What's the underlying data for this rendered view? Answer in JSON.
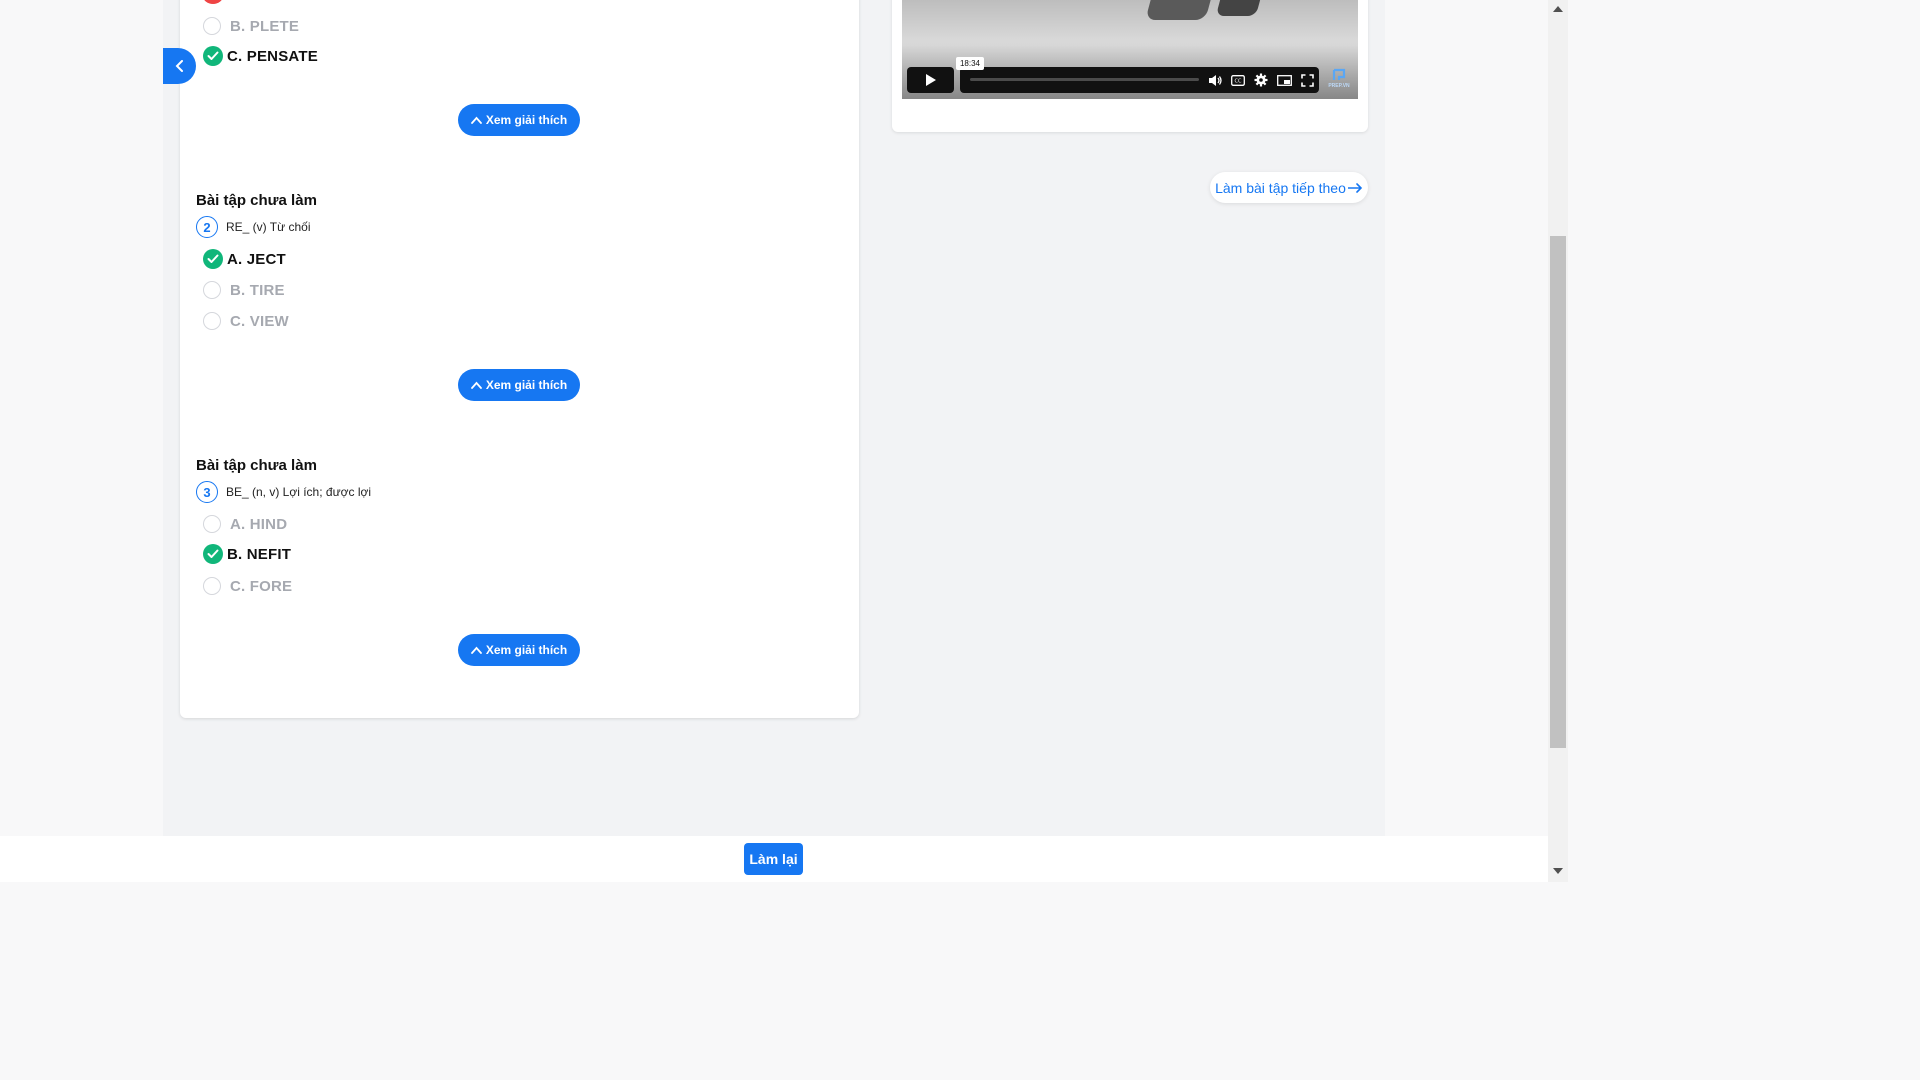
{
  "quiz": {
    "q1_tail": {
      "options": [
        {
          "label": "B. PLETE",
          "state": "unselected"
        },
        {
          "label": "C. PENSATE",
          "state": "correct"
        }
      ]
    },
    "explain_label": "Xem giải thích",
    "questions": [
      {
        "status": "Bài tập chưa làm",
        "number": "2",
        "prompt": "RE_ (v) Từ chối",
        "options": [
          {
            "label": "A. JECT",
            "state": "correct"
          },
          {
            "label": "B. TIRE",
            "state": "unselected"
          },
          {
            "label": "C. VIEW",
            "state": "unselected"
          }
        ]
      },
      {
        "status": "Bài tập chưa làm",
        "number": "3",
        "prompt": "BE_ (n, v) Lợi ích; được lợi",
        "options": [
          {
            "label": "A. HIND",
            "state": "unselected"
          },
          {
            "label": "B. NEFIT",
            "state": "correct"
          },
          {
            "label": "C. FORE",
            "state": "unselected"
          }
        ]
      }
    ]
  },
  "video": {
    "time_tooltip": "18:34",
    "logo_text": "PREP.VN",
    "icons": [
      "play-icon",
      "volume-icon",
      "captions-icon",
      "settings-icon",
      "pip-icon",
      "fullscreen-icon"
    ]
  },
  "next_exercise_label": "Làm bài tập tiếp theo",
  "retry_label": "Làm lại",
  "colors": {
    "accent": "#1677f2",
    "correct": "#10b67a",
    "wrong": "#ef4444",
    "muted": "#a6a9b0"
  }
}
